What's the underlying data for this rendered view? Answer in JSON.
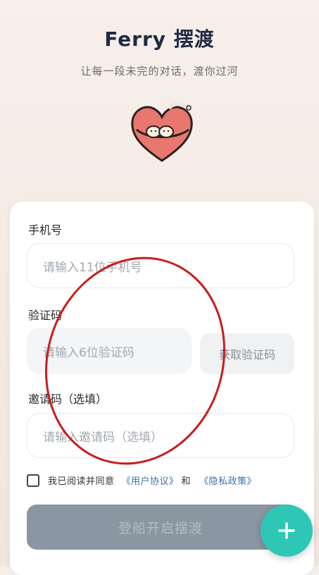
{
  "header": {
    "title": "Ferry 摆渡",
    "subtitle": "让每一段未完的对话，渡你过河"
  },
  "form": {
    "phone_label": "手机号",
    "phone_placeholder": "请输入11位手机号",
    "code_label": "验证码",
    "code_placeholder": "请输入6位验证码",
    "get_code_button": "获取验证码",
    "invite_label": "邀请码（选填）",
    "invite_placeholder": "请输入邀请码（选填）",
    "agree_prefix": "我已阅读并同意",
    "user_agreement_link": "《用户协议》",
    "agree_and": "和",
    "privacy_link": "《隐私政策》",
    "submit_button": "登船开启摆渡"
  },
  "colors": {
    "accent": "#2ec7b6",
    "title": "#1f2a44",
    "link": "#3a6fa8",
    "annotation": "#c71d1d"
  },
  "icons": {
    "logo": "heart-logo-icon",
    "fab": "plus-icon"
  }
}
